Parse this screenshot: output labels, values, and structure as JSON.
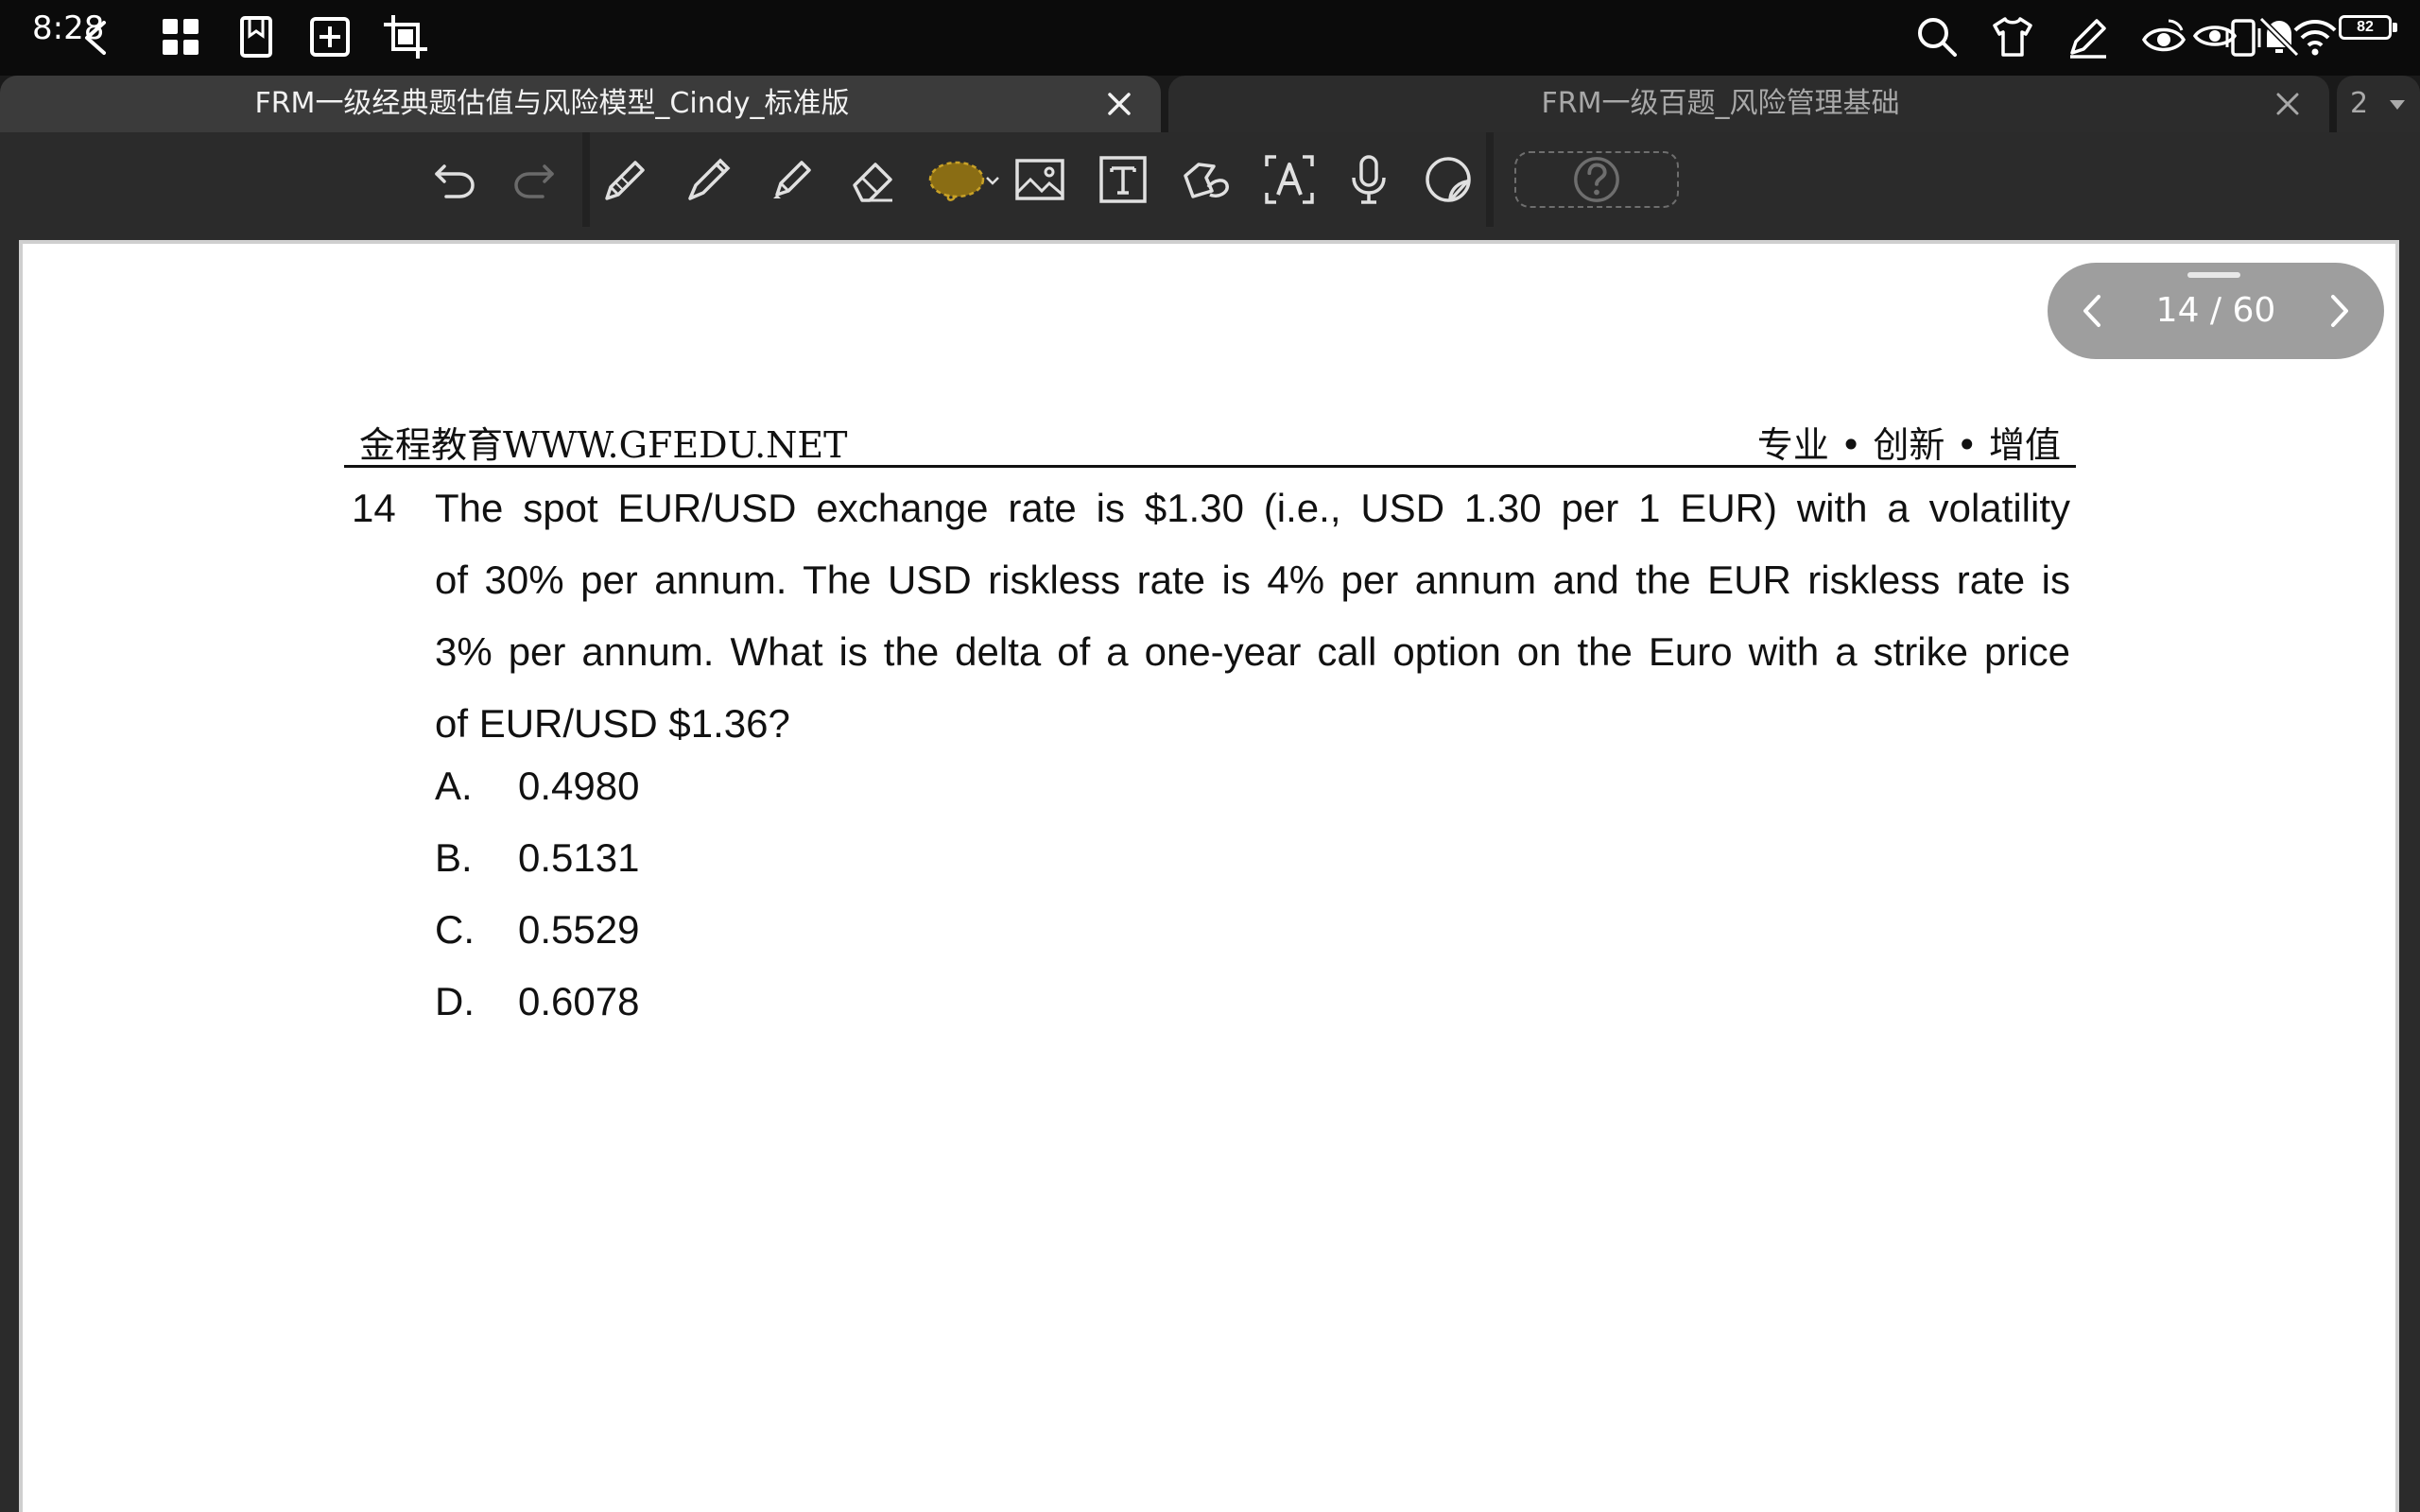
{
  "status_bar": {
    "time": "8:28",
    "battery": "82",
    "icons_left": [
      "back-chevron-icon",
      "grid-apps-icon",
      "bookmark-icon",
      "add-box-icon",
      "crop-icon"
    ],
    "icons_right": [
      "search-icon",
      "shirt-icon",
      "pen-icon",
      "eye-icon",
      "eye-icon",
      "vibrate-icon",
      "bell-muted-icon",
      "wifi-icon",
      "battery-icon"
    ]
  },
  "tabs": [
    {
      "title": "FRM一级经典题估值与风险模型_Cindy_标准版",
      "active": true
    },
    {
      "title": "FRM一级百题_风险管理基础",
      "active": false
    }
  ],
  "tab_count": "2",
  "toolbar": {
    "tools": [
      "undo-icon",
      "redo-icon",
      "pencil-icon",
      "pen-icon",
      "highlighter-icon",
      "eraser-icon",
      "lasso-icon",
      "image-icon",
      "text-box-icon",
      "shape-icon",
      "text-recognition-icon",
      "microphone-icon",
      "sticker-icon",
      "help-icon"
    ],
    "accent": "#c9a227"
  },
  "page_nav": {
    "current": "14",
    "total": "60",
    "label": "14 / 60"
  },
  "document": {
    "header_left": "金程教育WWW.GFEDU.NET",
    "header_right": "专业 • 创新 • 增值",
    "question_number": "14",
    "question_lines": [
      "The spot EUR/USD exchange rate is $1.30 (i.e., USD 1.30 per 1 EUR) with a volatility",
      "of 30% per annum. The USD riskless rate is 4% per annum and the EUR riskless rate is",
      "3% per annum. What is the delta of a one-year call option on the Euro with a strike price",
      "of EUR/USD $1.36?"
    ],
    "options": [
      {
        "letter": "A.",
        "value": "0.4980"
      },
      {
        "letter": "B.",
        "value": "0.5131"
      },
      {
        "letter": "C.",
        "value": "0.5529"
      },
      {
        "letter": "D.",
        "value": "0.6078"
      }
    ]
  }
}
